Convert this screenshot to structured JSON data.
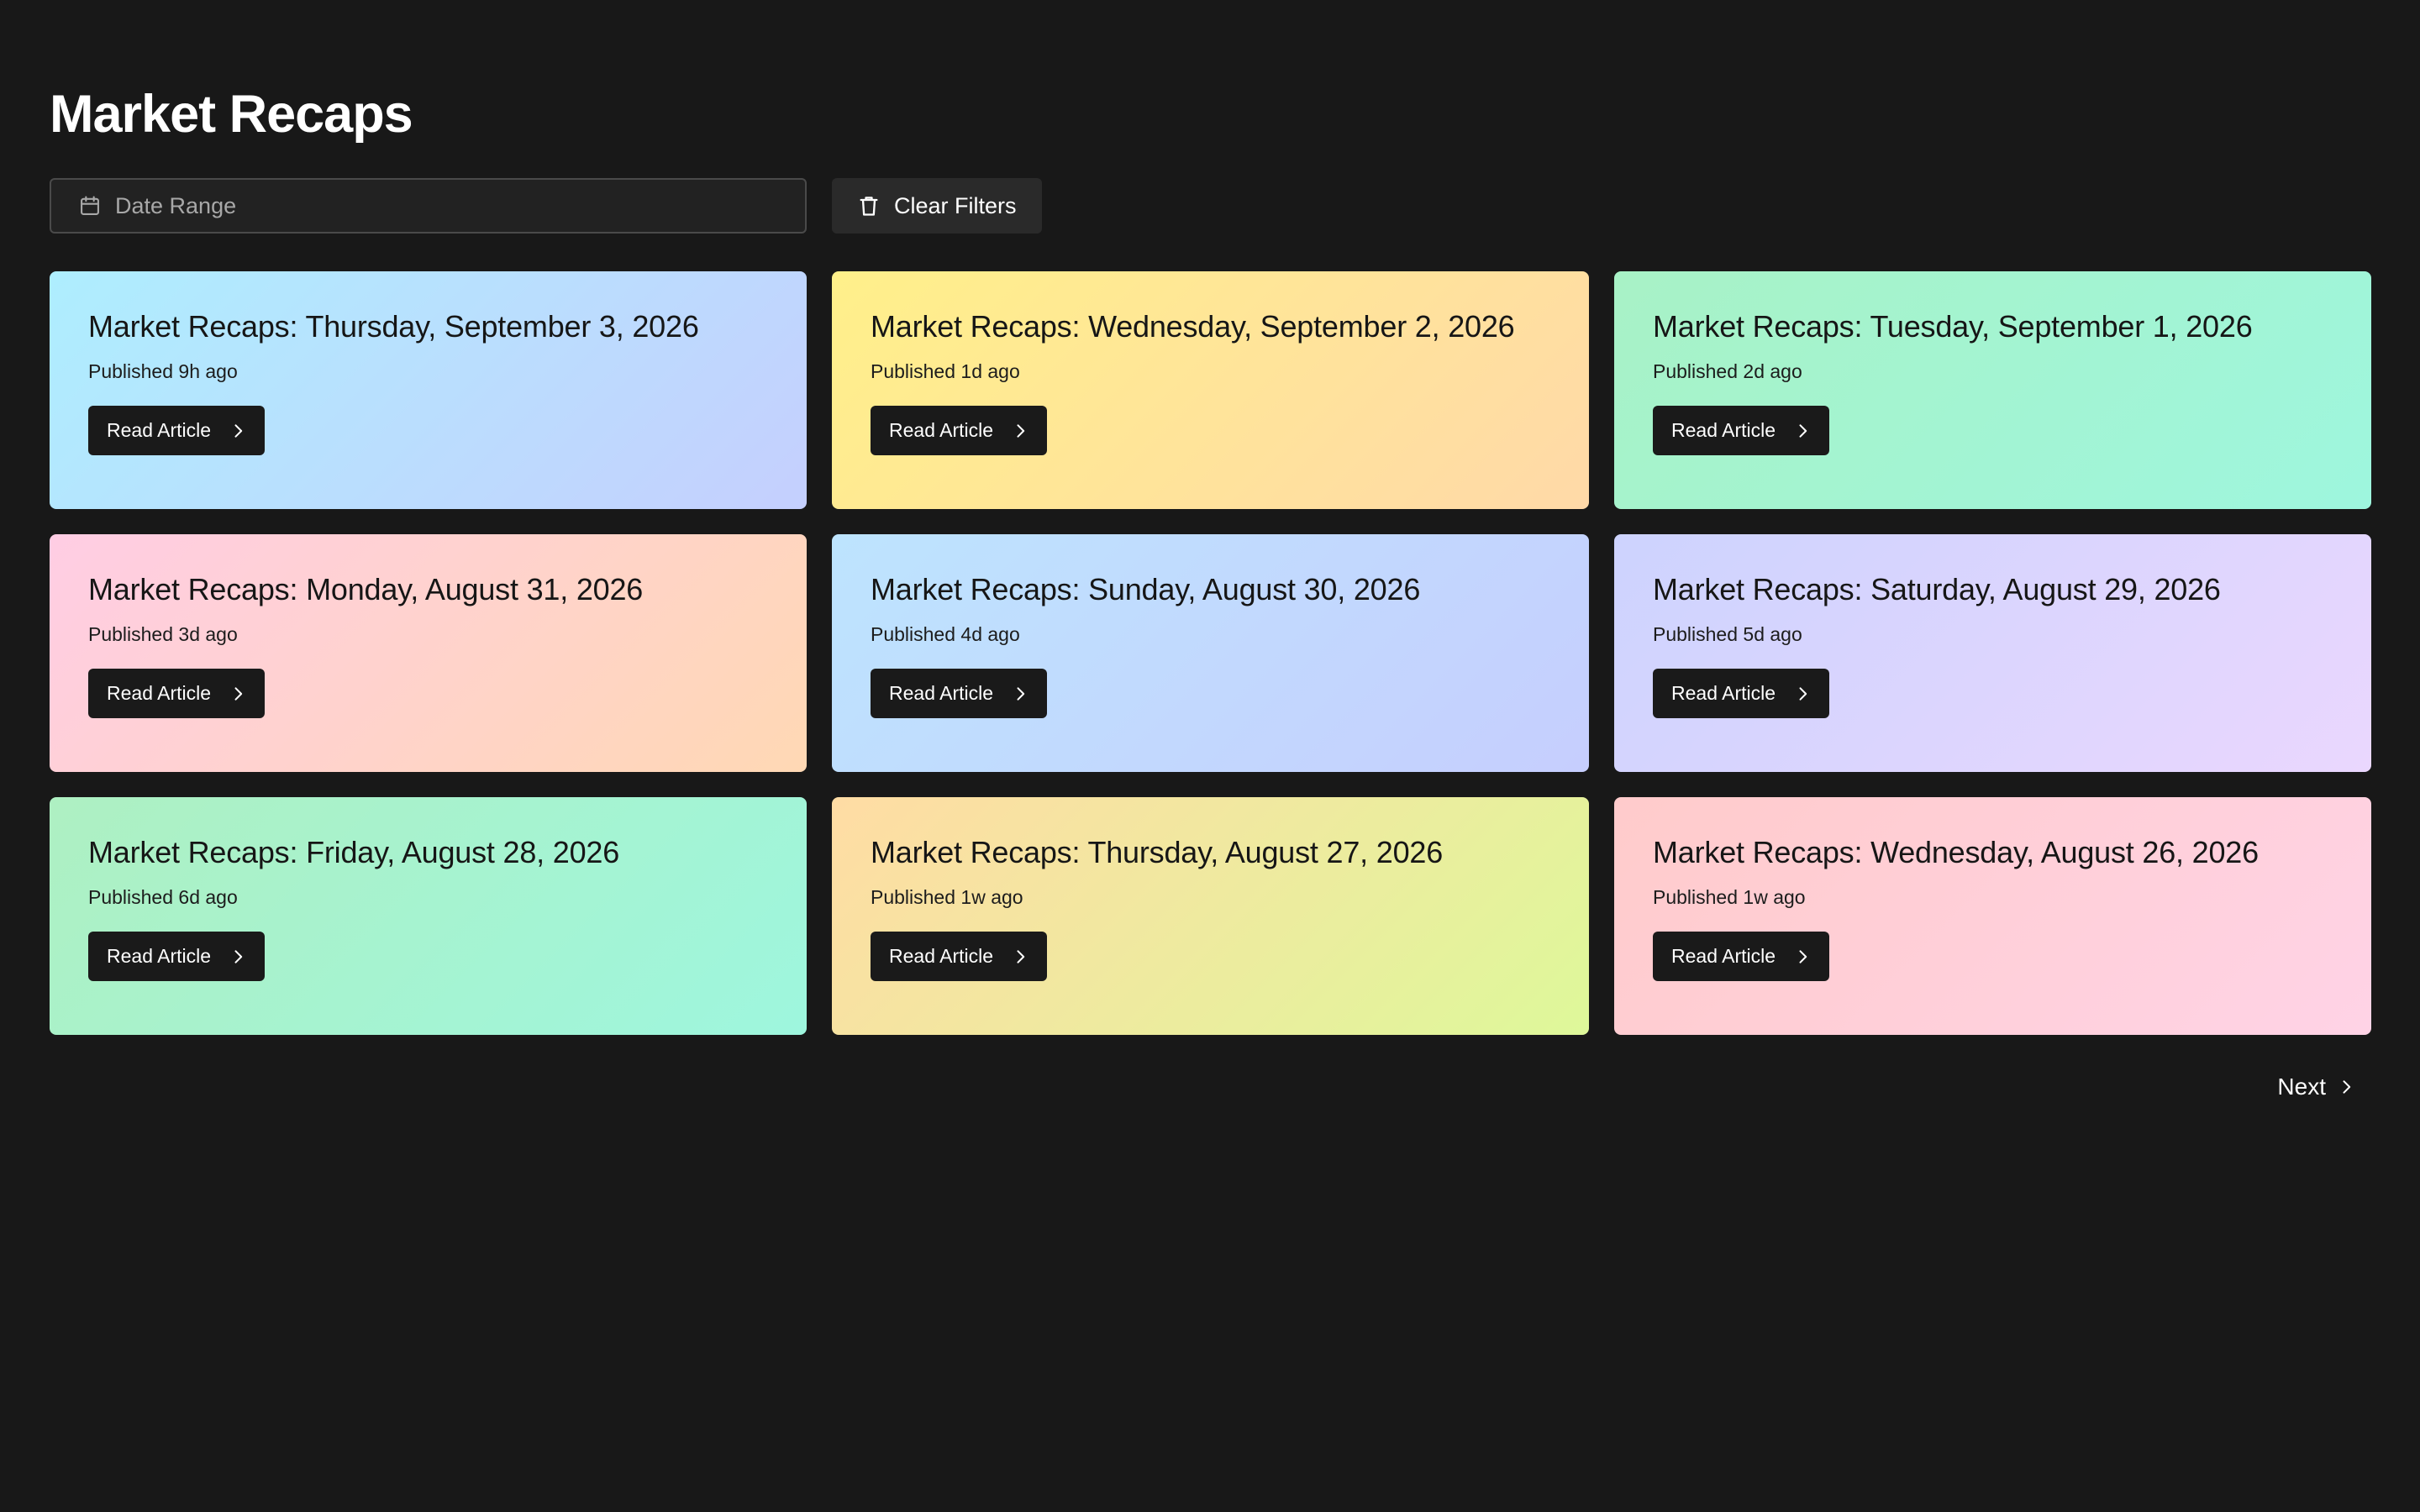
{
  "header": {
    "title": "Market Recaps"
  },
  "filters": {
    "date_range_placeholder": "Date Range",
    "clear_label": "Clear Filters"
  },
  "cards": [
    {
      "title": "Market Recaps: Thursday, September 3, 2026",
      "published": "Published 9h ago",
      "button": "Read Article",
      "gradient": [
        "#aeeefe",
        "#c5cffe"
      ]
    },
    {
      "title": "Market Recaps: Wednesday, September 2, 2026",
      "published": "Published 1d ago",
      "button": "Read Article",
      "gradient": [
        "#fff08a",
        "#ffd9a8"
      ]
    },
    {
      "title": "Market Recaps: Tuesday, September 1, 2026",
      "published": "Published 2d ago",
      "button": "Read Article",
      "gradient": [
        "#a8f2c6",
        "#9ef6de"
      ]
    },
    {
      "title": "Market Recaps: Monday, August 31, 2026",
      "published": "Published 3d ago",
      "button": "Read Article",
      "gradient": [
        "#ffcde4",
        "#ffd8b4"
      ]
    },
    {
      "title": "Market Recaps: Sunday, August 30, 2026",
      "published": "Published 4d ago",
      "button": "Read Article",
      "gradient": [
        "#bde4fe",
        "#c6cefe"
      ]
    },
    {
      "title": "Market Recaps: Saturday, August 29, 2026",
      "published": "Published 5d ago",
      "button": "Read Article",
      "gradient": [
        "#cdd3fe",
        "#ead7fe"
      ]
    },
    {
      "title": "Market Recaps: Friday, August 28, 2026",
      "published": "Published 6d ago",
      "button": "Read Article",
      "gradient": [
        "#aef0c2",
        "#9ef6de"
      ]
    },
    {
      "title": "Market Recaps: Thursday, August 27, 2026",
      "published": "Published 1w ago",
      "button": "Read Article",
      "gradient": [
        "#ffdca4",
        "#def89a"
      ]
    },
    {
      "title": "Market Recaps: Wednesday, August 26, 2026",
      "published": "Published 1w ago",
      "button": "Read Article",
      "gradient": [
        "#ffcbcb",
        "#ffd3e6"
      ]
    }
  ],
  "pagination": {
    "next_label": "Next"
  },
  "icons": {
    "date_range": "calendar-icon",
    "clear": "trash-icon",
    "read": "chevron-right-icon",
    "next": "chevron-right-icon"
  }
}
